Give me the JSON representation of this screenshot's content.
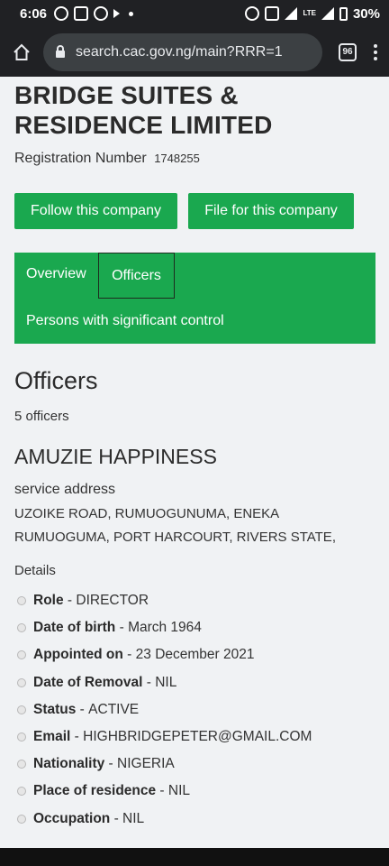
{
  "status_bar": {
    "time": "6:06",
    "battery": "30%",
    "network": "LTE"
  },
  "browser": {
    "url": "search.cac.gov.ng/main?RRR=1",
    "tab_count": "96"
  },
  "company": {
    "name": "BRIDGE SUITES & RESIDENCE LIMITED",
    "reg_label": "Registration Number",
    "reg_number": "1748255"
  },
  "buttons": {
    "follow": "Follow this company",
    "file": "File for this company"
  },
  "tabs": {
    "overview": "Overview",
    "officers": "Officers",
    "psc": "Persons with significant control"
  },
  "officers_section": {
    "heading": "Officers",
    "count": "5 officers",
    "officer": {
      "name": "AMUZIE HAPPINESS",
      "service_label": "service address",
      "address": "UZOIKE ROAD, RUMUOGUNUMA, ENEKA RUMUOGUMA, PORT HARCOURT, RIVERS STATE,",
      "details_label": "Details",
      "details": [
        {
          "key": "Role",
          "value": "DIRECTOR"
        },
        {
          "key": "Date of birth",
          "value": "March 1964"
        },
        {
          "key": "Appointed on",
          "value": "23 December 2021"
        },
        {
          "key": "Date of Removal",
          "value": "NIL"
        },
        {
          "key": "Status",
          "value": "ACTIVE"
        },
        {
          "key": "Email",
          "value": "HIGHBRIDGEPETER@GMAIL.COM"
        },
        {
          "key": "Nationality",
          "value": "NIGERIA"
        },
        {
          "key": "Place of residence",
          "value": "NIL"
        },
        {
          "key": "Occupation",
          "value": "NIL"
        }
      ]
    }
  },
  "colors": {
    "accent_green": "#1aa84f",
    "page_bg": "#f0f2f4",
    "chrome_bg": "#202124"
  }
}
